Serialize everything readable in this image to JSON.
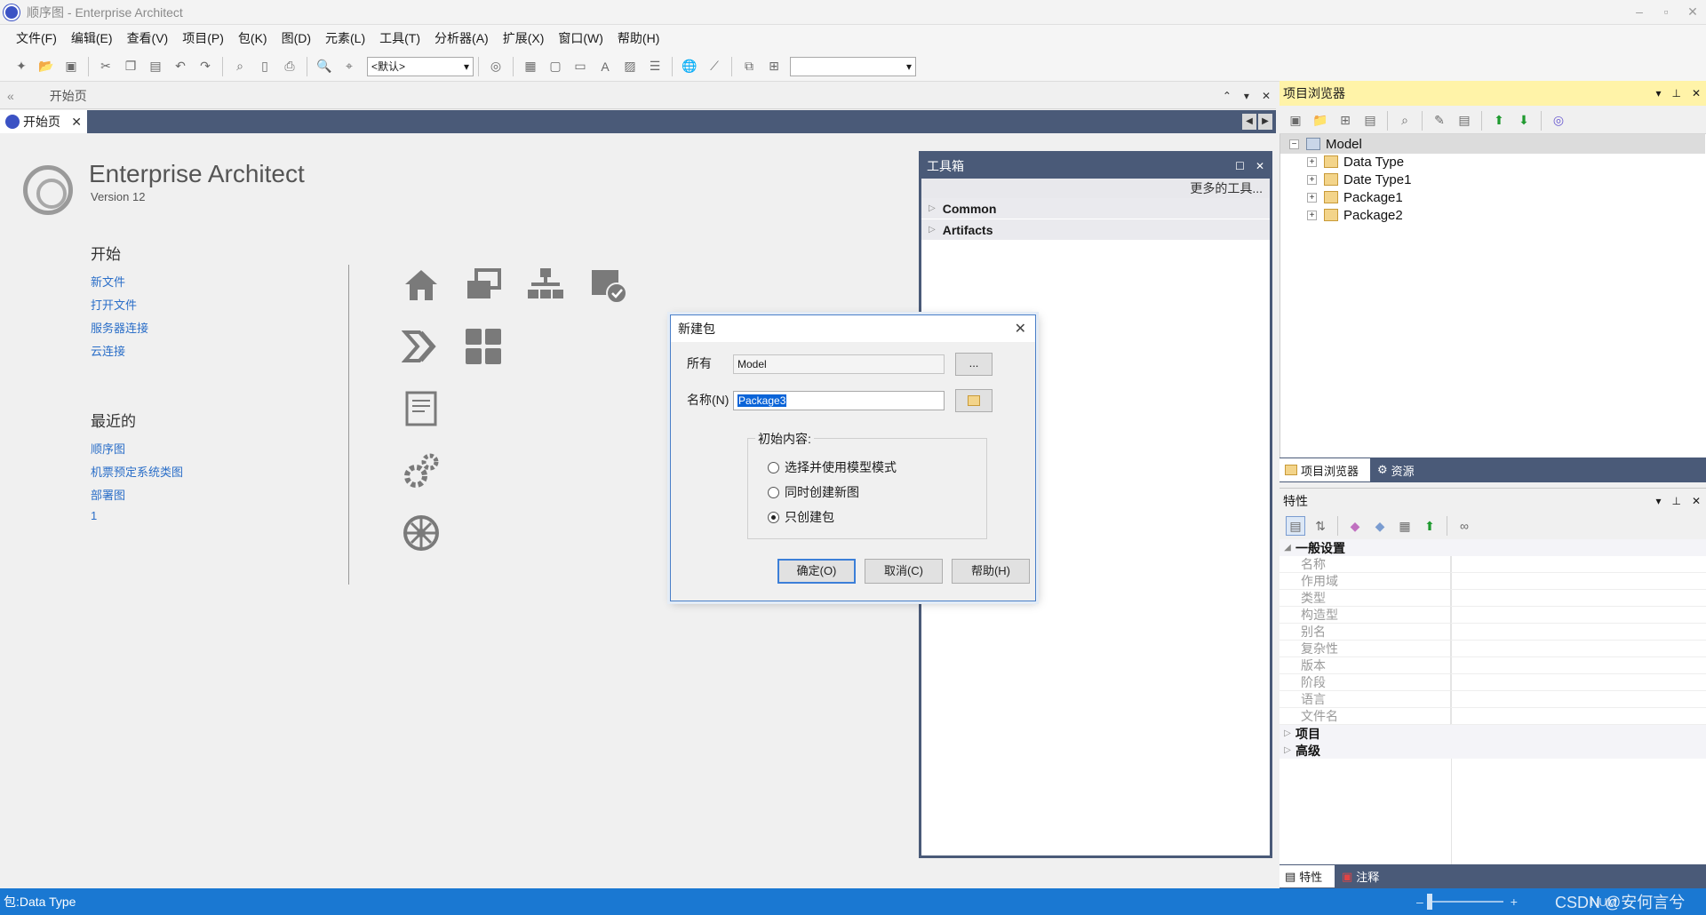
{
  "window": {
    "title": "顺序图 - Enterprise Architect",
    "controls": [
      "–",
      "▫",
      "✕"
    ]
  },
  "menu": [
    "文件(F)",
    "编辑(E)",
    "查看(V)",
    "项目(P)",
    "包(K)",
    "图(D)",
    "元素(L)",
    "工具(T)",
    "分析器(A)",
    "扩展(X)",
    "窗口(W)",
    "帮助(H)"
  ],
  "toolbar": {
    "workspace_select": "<默认>",
    "second_select": ""
  },
  "doc_pane": {
    "header_label": "开始页",
    "tab_label": "开始页"
  },
  "start_page": {
    "product_name": "Enterprise Architect",
    "version": "Version 12",
    "start_title": "开始",
    "start_links": [
      "新文件",
      "打开文件",
      "服务器连接",
      "云连接"
    ],
    "recent_title": "最近的",
    "recent_links": [
      "顺序图",
      "机票预定系统类图",
      "部署图",
      "1"
    ]
  },
  "toolbox": {
    "title": "工具箱",
    "more_tools": "更多的工具...",
    "groups": [
      "Common",
      "Artifacts"
    ]
  },
  "dialog": {
    "title": "新建包",
    "owner_label": "所有",
    "owner_value": "Model",
    "browse_label": "...",
    "name_label": "名称(N)",
    "name_value": "Package3",
    "group_title": "初始内容:",
    "options": [
      {
        "label": "选择并使用模型模式",
        "selected": false
      },
      {
        "label": "同时创建新图",
        "selected": false
      },
      {
        "label": "只创建包",
        "selected": true
      }
    ],
    "ok": "确定(O)",
    "cancel": "取消(C)",
    "help": "帮助(H)"
  },
  "project_browser": {
    "title": "项目浏览器",
    "root": "Model",
    "items": [
      "Data Type",
      "Date Type1",
      "Package1",
      "Package2"
    ],
    "tab_browser": "项目浏览器",
    "tab_resources": "资源"
  },
  "properties": {
    "title": "特性",
    "general_section": "一般设置",
    "fields": [
      "名称",
      "作用域",
      "类型",
      "构造型",
      "别名",
      "复杂性",
      "版本",
      "阶段",
      "语言",
      "文件名"
    ],
    "section_project": "项目",
    "section_advanced": "高级",
    "tab_properties": "特性",
    "tab_notes": "注释"
  },
  "status": {
    "left_text": "包:Data Type",
    "zoom_minus": "–",
    "zoom_plus": "+",
    "num_indicator": "NUM",
    "watermark": "CSDN @安何言兮"
  },
  "colors": {
    "accent_blue": "#1a78d2",
    "tab_dark": "#4a5a78",
    "pb_header": "#fff3a8",
    "link": "#2a6ec8"
  }
}
